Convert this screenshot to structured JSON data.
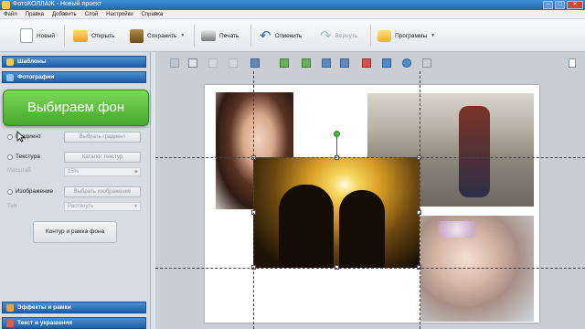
{
  "window": {
    "title": "ФотоКОЛЛАЖ - Новый проект"
  },
  "menu": [
    "Файл",
    "Правка",
    "Добавить",
    "Слой",
    "Настройки",
    "Справка"
  ],
  "toolbar": {
    "new_label": "Новый",
    "open_label": "Открыть",
    "save_label": "Сохранить",
    "print_label": "Печать",
    "undo_label": "Отменить",
    "redo_label": "Вернуть",
    "programs_label": "Программы"
  },
  "left_panel": {
    "templates_header": "Шаблоны",
    "photos_header": "Фотографии",
    "callout_text": "Выбираем фон",
    "gradient_label": "Градиент",
    "gradient_button": "Выбрать градиент",
    "texture_label": "Текстура",
    "texture_button": "Каталог текстур",
    "scale_label": "Масштаб",
    "scale_value": "15%",
    "image_label": "Изображение",
    "image_button": "Выбрать изображение",
    "type_label": "Тип",
    "type_value": "Растянуть",
    "frame_button": "Контур и рамка фона",
    "effects_header": "Эффекты и рамки",
    "text_header": "Текст и украшения"
  },
  "colors": {
    "header_blue": "#1e5ea8",
    "callout_green": "#43a82c",
    "rotation_handle": "#4cbb3a"
  }
}
